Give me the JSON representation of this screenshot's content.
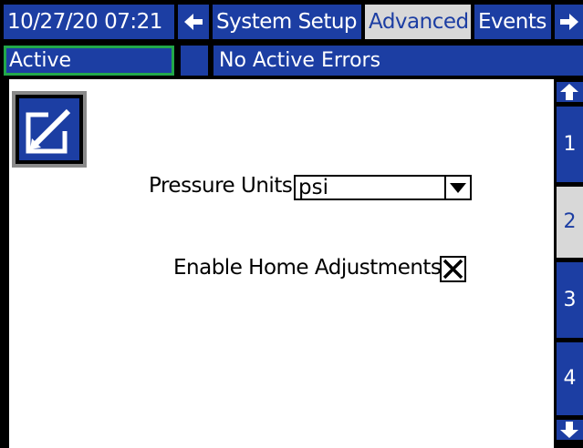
{
  "header": {
    "datetime": "10/27/20 07:21",
    "tabs": [
      {
        "label": "System Setup"
      },
      {
        "label": "Advanced"
      },
      {
        "label": "Events"
      }
    ]
  },
  "status": {
    "state": "Active",
    "errors": "No Active Errors"
  },
  "form": {
    "pressure_units_label": "Pressure Units:",
    "pressure_units_value": "psi",
    "enable_home_label": "Enable Home Adjustments:",
    "enable_home_checked": true
  },
  "pages": [
    {
      "label": "1"
    },
    {
      "label": "2",
      "active": true
    },
    {
      "label": "3"
    },
    {
      "label": "4"
    }
  ],
  "colors": {
    "accent": "#1c3ea3",
    "active_tab": "#d8d8d8",
    "status_border": "#22a84a"
  }
}
